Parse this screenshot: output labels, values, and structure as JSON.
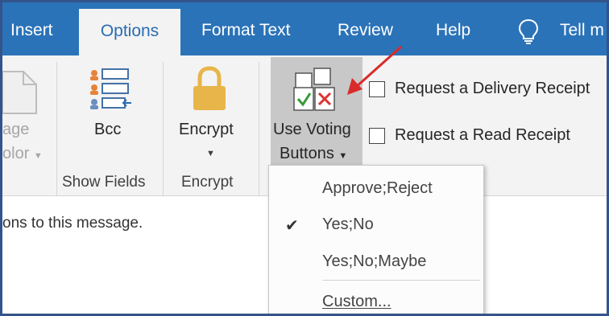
{
  "tabs": [
    {
      "label": "Insert",
      "active": false
    },
    {
      "label": "Options",
      "active": true
    },
    {
      "label": "Format Text",
      "active": false
    },
    {
      "label": "Review",
      "active": false
    },
    {
      "label": "Help",
      "active": false
    }
  ],
  "tell_me": "Tell m",
  "ribbon": {
    "page_color": {
      "line1": "age",
      "line2": "olor"
    },
    "bcc_label": "Bcc",
    "show_fields_group": "Show Fields",
    "encrypt_label": "Encrypt",
    "encrypt_group": "Encrypt",
    "voting": {
      "line1": "Use Voting",
      "line2": "Buttons"
    },
    "delivery_receipt": "Request a Delivery Receipt",
    "read_receipt": "Request a Read Receipt"
  },
  "message_text": "ons to this message.",
  "voting_menu": {
    "items": [
      {
        "label": "Approve;Reject",
        "checked": false
      },
      {
        "label": "Yes;No",
        "checked": true
      },
      {
        "label": "Yes;No;Maybe",
        "checked": false
      },
      {
        "label": "Custom...",
        "checked": false
      }
    ]
  },
  "colors": {
    "tab_bar": "#2b73b8",
    "active_tab_text": "#2b6cb0",
    "frame": "#33548a",
    "arrow": "#d92b2b",
    "lock": "#e8b54a"
  }
}
